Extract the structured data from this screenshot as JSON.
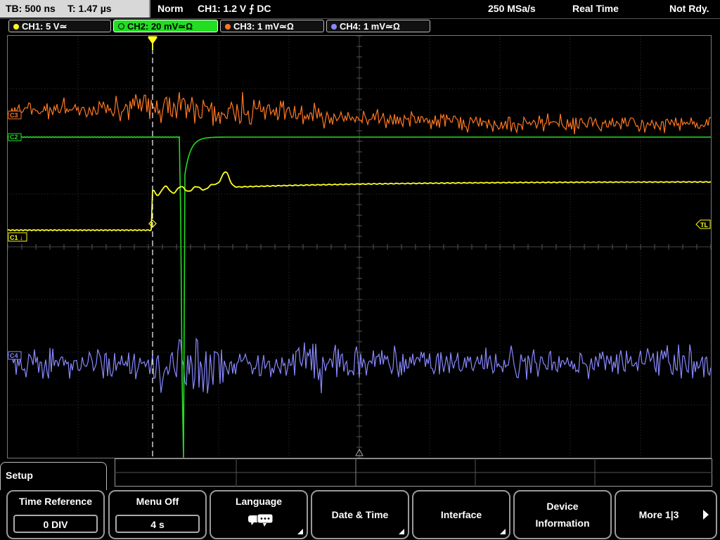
{
  "status": {
    "timebase": "TB: 500 ns",
    "trigger_time": "T: 1.47 µs",
    "mode": "Norm",
    "trigger_source": "CH1: 1.2 V ⨍ DC",
    "sample_rate": "250 MSa/s",
    "acq_mode": "Real Time",
    "state": "Not Rdy."
  },
  "channels": [
    {
      "label": "CH1: 5 V≃",
      "color": "#ffff22"
    },
    {
      "label": "CH2: 20 mV≃Ω",
      "color": "#22dd22"
    },
    {
      "label": "CH3: 1 mV≃Ω",
      "color": "#ff7722"
    },
    {
      "label": "CH4: 1 mV≃Ω",
      "color": "#8888ff"
    }
  ],
  "markers": {
    "ch3": "C3",
    "ch2": "C2",
    "ch1": "C1",
    "ch4": "C4",
    "trigger_level": "TL"
  },
  "menu": {
    "title": "Setup",
    "softkeys": [
      {
        "label": "Time Reference",
        "value": "0 DIV"
      },
      {
        "label": "Menu Off",
        "value": "4 s"
      },
      {
        "label": "Language",
        "icon": "speech-bubbles-icon"
      },
      {
        "label": "Date & Time"
      },
      {
        "label": "Interface"
      },
      {
        "label_line1": "Device",
        "label_line2": "Information"
      },
      {
        "label": "More 1|3"
      }
    ]
  }
}
